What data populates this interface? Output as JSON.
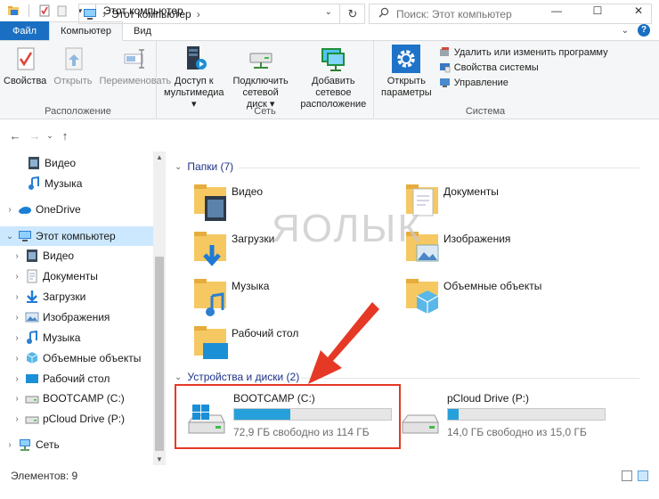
{
  "window": {
    "title": "Этот компьютер",
    "minimize": "—",
    "maximize": "☐",
    "close": "✕"
  },
  "tabs": [
    {
      "label": "Файл"
    },
    {
      "label": "Компьютер"
    },
    {
      "label": "Вид"
    }
  ],
  "ribbon": {
    "location": {
      "label": "Расположение",
      "buttons": [
        "Свойства",
        "Открыть",
        "Переименовать"
      ]
    },
    "network": {
      "label": "Сеть",
      "buttons": [
        {
          "line1": "Доступ к",
          "line2": "мультимедиа ▾"
        },
        {
          "line1": "Подключить",
          "line2": "сетевой диск ▾"
        },
        {
          "line1": "Добавить сетевое",
          "line2": "расположение"
        }
      ]
    },
    "system": {
      "label": "Система",
      "open_settings": {
        "line1": "Открыть",
        "line2": "параметры"
      },
      "items": [
        "Удалить или изменить программу",
        "Свойства системы",
        "Управление"
      ]
    }
  },
  "address": {
    "path": "Этот компьютер",
    "separator": "›",
    "search_placeholder": "Поиск: Этот компьютер"
  },
  "nav": {
    "items": [
      {
        "label": "Видео",
        "icon": "video-icon"
      },
      {
        "label": "Музыка",
        "icon": "music-icon"
      },
      {
        "label": "OneDrive",
        "icon": "cloud-icon"
      },
      {
        "label": "Этот компьютер",
        "icon": "computer-icon"
      },
      {
        "label": "Видео",
        "icon": "video-icon"
      },
      {
        "label": "Документы",
        "icon": "document-icon"
      },
      {
        "label": "Загрузки",
        "icon": "download-icon"
      },
      {
        "label": "Изображения",
        "icon": "image-icon"
      },
      {
        "label": "Музыка",
        "icon": "music-icon"
      },
      {
        "label": "Объемные объекты",
        "icon": "cube-icon"
      },
      {
        "label": "Рабочий стол",
        "icon": "desktop-icon"
      },
      {
        "label": "BOOTCAMP (C:)",
        "icon": "drive-icon"
      },
      {
        "label": "pCloud Drive (P:)",
        "icon": "drive-icon"
      },
      {
        "label": "Сеть",
        "icon": "network-icon"
      }
    ]
  },
  "content": {
    "folders_header": "Папки (7)",
    "folders": [
      {
        "label": "Видео",
        "icon": "video-folder-icon"
      },
      {
        "label": "Документы",
        "icon": "documents-folder-icon"
      },
      {
        "label": "Загрузки",
        "icon": "downloads-folder-icon"
      },
      {
        "label": "Изображения",
        "icon": "pictures-folder-icon"
      },
      {
        "label": "Музыка",
        "icon": "music-folder-icon"
      },
      {
        "label": "Объемные объекты",
        "icon": "3d-folder-icon"
      },
      {
        "label": "Рабочий стол",
        "icon": "desktop-folder-icon"
      }
    ],
    "drives_header": "Устройства и диски (2)",
    "drives": [
      {
        "label": "BOOTCAMP (C:)",
        "status": "72,9 ГБ свободно из 114 ГБ",
        "used_fraction": 0.36,
        "icon": "windows-drive-icon"
      },
      {
        "label": "pCloud Drive (P:)",
        "status": "14,0 ГБ свободно из 15,0 ГБ",
        "used_fraction": 0.07,
        "icon": "drive-icon"
      }
    ]
  },
  "watermark": "ЯОЛЫК",
  "status": {
    "items": "Элементов: 9"
  },
  "colors": {
    "accent": "#1a6fc2",
    "selection": "#cce8ff",
    "drive_fill": "#26a0da",
    "highlight": "#e53825",
    "folder": "#f5c862"
  }
}
